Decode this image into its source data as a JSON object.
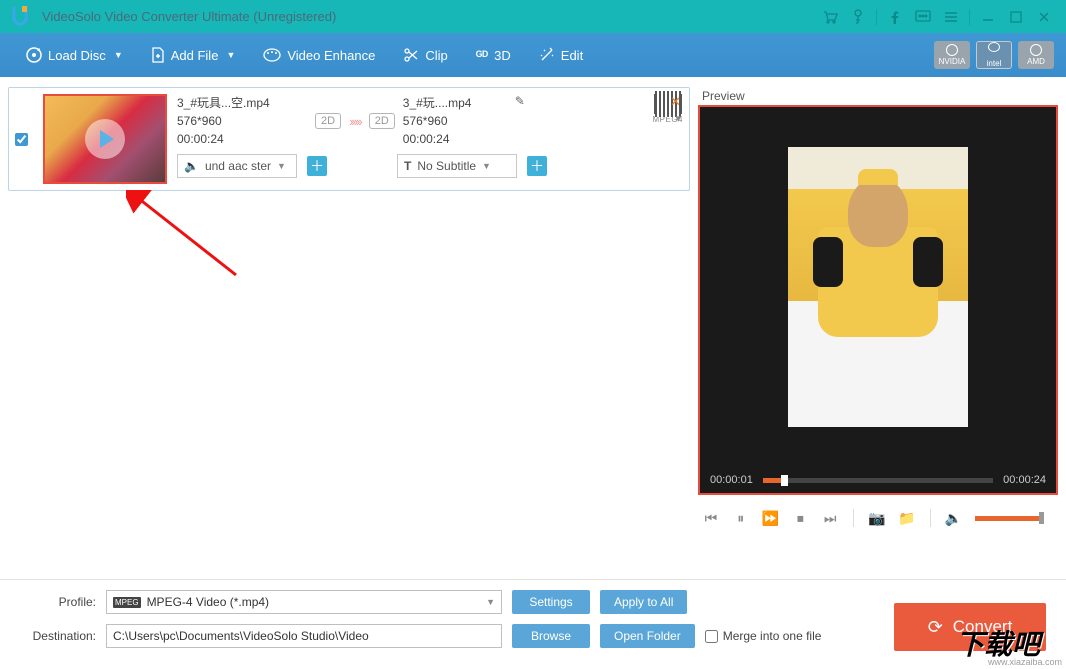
{
  "titlebar": {
    "title": "VideoSolo Video Converter Ultimate (Unregistered)"
  },
  "toolbar": {
    "load_disc": "Load Disc",
    "add_file": "Add File",
    "enhance": "Video Enhance",
    "clip": "Clip",
    "threeD": "3D",
    "edit": "Edit",
    "chips": {
      "nvidia": "NVIDIA",
      "intel": "intel",
      "amd": "AMD"
    }
  },
  "item": {
    "src": {
      "name": "3_#玩具...空.mp4",
      "res": "576*960",
      "dur": "00:00:24",
      "badge": "2D"
    },
    "dst": {
      "name": "3_#玩....mp4",
      "res": "576*960",
      "dur": "00:00:24",
      "badge": "2D"
    },
    "codec": "MPEG4",
    "audio_sel": "und aac ster",
    "sub_sel": "No Subtitle"
  },
  "preview": {
    "label": "Preview",
    "cur": "00:00:01",
    "total": "00:00:24"
  },
  "bottom": {
    "profile_lbl": "Profile:",
    "profile_val": "MPEG-4 Video (*.mp4)",
    "dest_lbl": "Destination:",
    "dest_val": "C:\\Users\\pc\\Documents\\VideoSolo Studio\\Video",
    "settings": "Settings",
    "apply_all": "Apply to All",
    "browse": "Browse",
    "open_folder": "Open Folder",
    "merge": "Merge into one file",
    "convert": "Convert"
  },
  "watermark": "www.xiazaiba.com",
  "dlba": "下载吧"
}
